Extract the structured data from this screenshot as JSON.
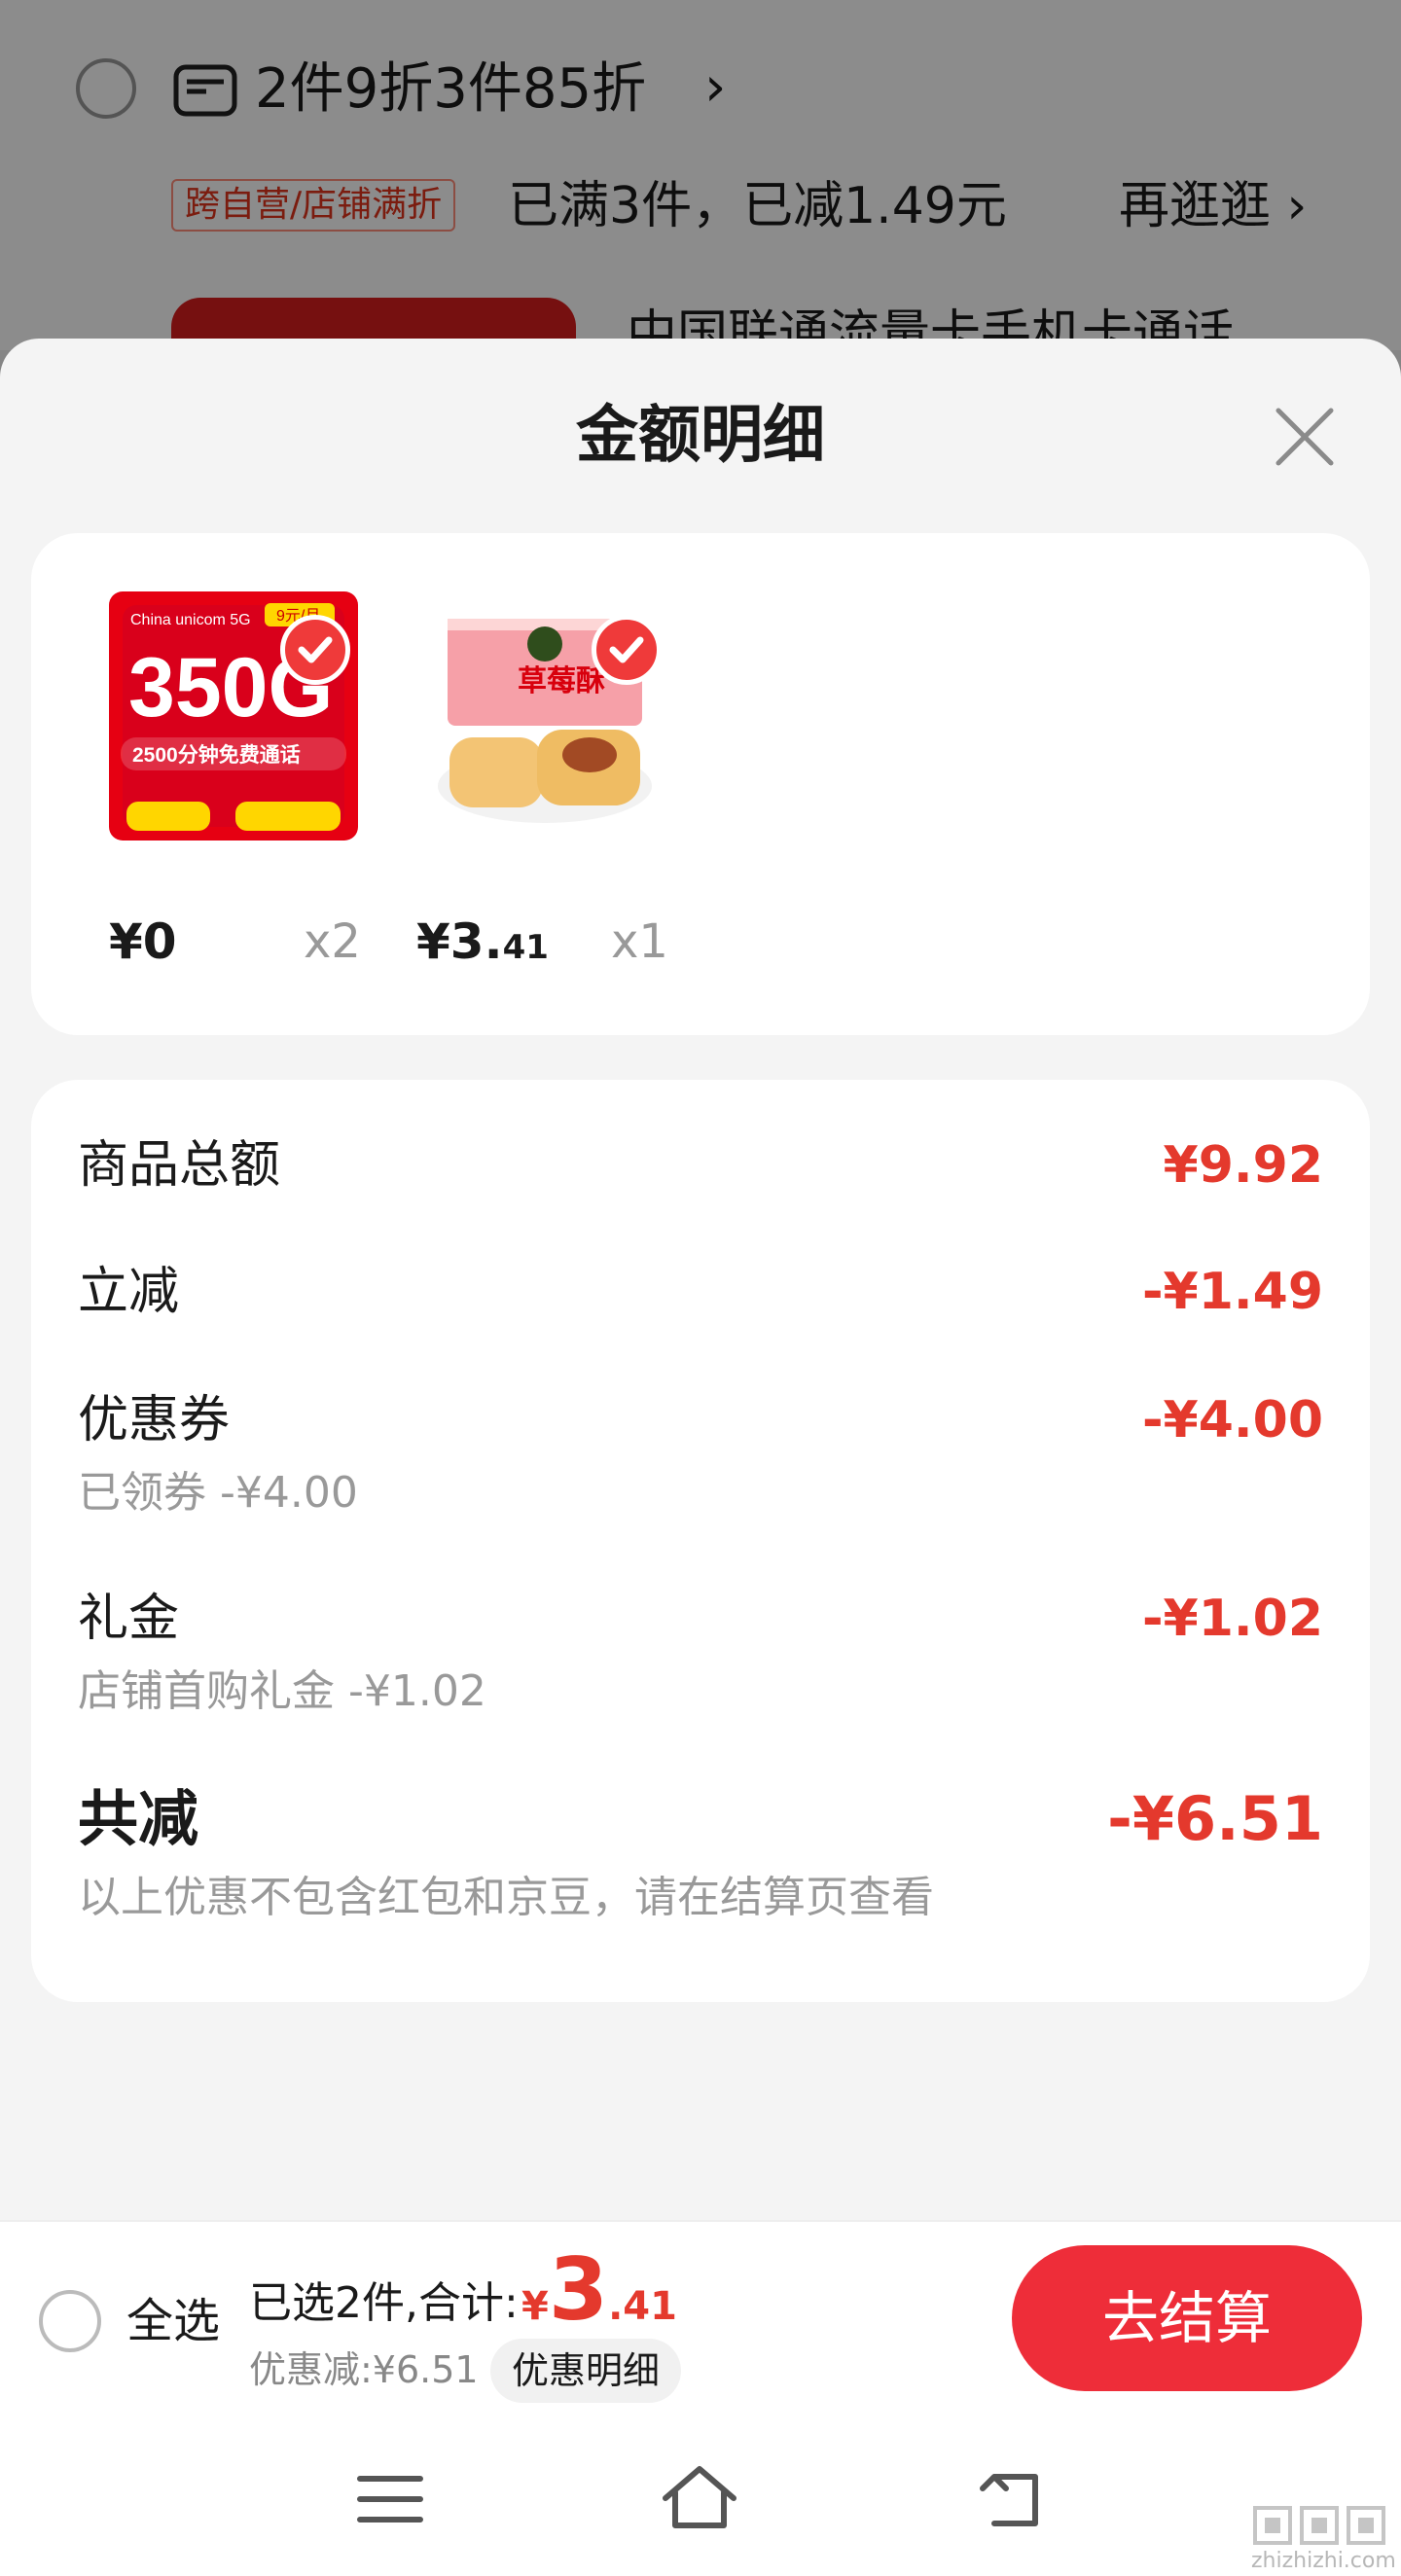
{
  "background": {
    "promo_title": "2件9折3件85折",
    "promo_chevron": "›",
    "tag": "跨自营/店铺满折",
    "tag_text": "已满3件，已减1.49元",
    "more": "再逛逛 ›",
    "product_title": "中国联通流量卡手机卡通话"
  },
  "sheet": {
    "title": "金额明细"
  },
  "products": [
    {
      "price": "¥0",
      "qty": "x2",
      "image_text": "350G",
      "image_sub": "2500分钟免费通话"
    },
    {
      "price_int": "¥3.",
      "price_dec": "41",
      "qty": "x1",
      "image_text": "草莓酥"
    }
  ],
  "details": {
    "subtotal_label": "商品总额",
    "subtotal_value": "¥9.92",
    "instant_label": "立减",
    "instant_value": "-¥1.49",
    "coupon_label": "优惠券",
    "coupon_sub": "已领券 -¥4.00",
    "coupon_value": "-¥4.00",
    "gift_label": "礼金",
    "gift_sub": "店铺首购礼金 -¥1.02",
    "gift_value": "-¥1.02",
    "total_label": "共减",
    "total_sub": "以上优惠不包含红包和京豆，请在结算页查看",
    "total_value": "-¥6.51"
  },
  "bottom_bar": {
    "select_all": "全选",
    "summary_label": "已选2件,合计:",
    "sum_yen": "¥",
    "sum_int": "3",
    "sum_dec": ".41",
    "discount": "优惠减:¥6.51",
    "discount_button": "优惠明细",
    "checkout": "去结算"
  },
  "watermark": "zhizhizhi.com",
  "colors": {
    "accent": "#e4392d",
    "checkout": "#ee2d39"
  }
}
